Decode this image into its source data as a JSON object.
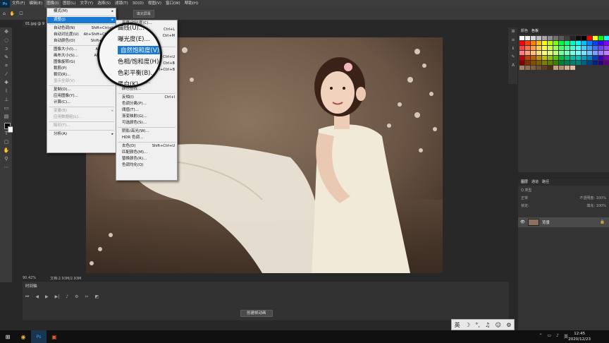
{
  "menubar": {
    "logo": "Ps",
    "items": [
      "文件(F)",
      "编辑(E)",
      "图像(I)",
      "图层(L)",
      "文字(Y)",
      "选择(S)",
      "滤镜(T)",
      "3D(D)",
      "视图(V)",
      "窗口(W)",
      "帮助(H)"
    ]
  },
  "optbar": {
    "hint": "填充屏幕"
  },
  "document": {
    "tab": "01.jpg @ 9"
  },
  "status": {
    "zoom": "90.42%",
    "doc": "文档:2.93M/2.93M"
  },
  "timeline": {
    "title": "时间轴",
    "create_button": "创建帧动画"
  },
  "image_menu": {
    "items": [
      {
        "label": "模式(M)",
        "shortcut": "",
        "arrow": true
      },
      {
        "sep": true
      },
      {
        "label": "调整(J)",
        "shortcut": "",
        "arrow": true,
        "highlight": true
      },
      {
        "sep": true
      },
      {
        "label": "自动色调(N)",
        "shortcut": "Shift+Ctrl+L"
      },
      {
        "label": "自动对比度(U)",
        "shortcut": "Alt+Shift+Ctrl+L"
      },
      {
        "label": "自动颜色(O)",
        "shortcut": "Shift+Ctrl+B"
      },
      {
        "sep": true
      },
      {
        "label": "图像大小(I)...",
        "shortcut": "Alt+Ctrl+I"
      },
      {
        "label": "画布大小(S)...",
        "shortcut": "Alt+Ctrl+C"
      },
      {
        "label": "图像旋转(G)",
        "shortcut": "",
        "arrow": true
      },
      {
        "label": "裁剪(P)",
        "shortcut": ""
      },
      {
        "label": "裁切(R)...",
        "shortcut": ""
      },
      {
        "label": "显示全部(V)",
        "shortcut": "",
        "disabled": true
      },
      {
        "sep": true
      },
      {
        "label": "复制(D)...",
        "shortcut": ""
      },
      {
        "label": "应用图像(Y)...",
        "shortcut": ""
      },
      {
        "label": "计算(C)...",
        "shortcut": ""
      },
      {
        "sep": true
      },
      {
        "label": "变量(B)",
        "shortcut": "",
        "arrow": true,
        "disabled": true
      },
      {
        "label": "应用数据组(L)...",
        "shortcut": "",
        "disabled": true
      },
      {
        "sep": true
      },
      {
        "label": "陷印(T)...",
        "shortcut": "",
        "disabled": true
      },
      {
        "sep": true
      },
      {
        "label": "分析(A)",
        "shortcut": "",
        "arrow": true
      }
    ]
  },
  "adjust_menu": {
    "items": [
      {
        "label": "亮度/对比度(C)...",
        "shortcut": ""
      },
      {
        "label": "色阶(L)...",
        "shortcut": "Ctrl+L"
      },
      {
        "label": "曲线(U)...",
        "shortcut": "Ctrl+M"
      },
      {
        "label": "曝光度(E)...",
        "shortcut": ""
      },
      {
        "sep": true
      },
      {
        "label": "自然饱和度(V)...",
        "shortcut": ""
      },
      {
        "label": "色相/饱和度(H)...",
        "shortcut": "Ctrl+U"
      },
      {
        "label": "色彩平衡(B)...",
        "shortcut": "Ctrl+B"
      },
      {
        "label": "黑白(K)...",
        "shortcut": "Alt+Shift+Ctrl+B"
      },
      {
        "label": "照片滤镜(F)...",
        "shortcut": ""
      },
      {
        "label": "通道混合器(X)...",
        "shortcut": ""
      },
      {
        "label": "颜色查找...",
        "shortcut": ""
      },
      {
        "sep": true
      },
      {
        "label": "反相(I)",
        "shortcut": "Ctrl+I"
      },
      {
        "label": "色调分离(P)...",
        "shortcut": ""
      },
      {
        "label": "阈值(T)...",
        "shortcut": ""
      },
      {
        "label": "渐变映射(G)...",
        "shortcut": ""
      },
      {
        "label": "可选颜色(S)...",
        "shortcut": ""
      },
      {
        "sep": true
      },
      {
        "label": "阴影/高光(W)...",
        "shortcut": ""
      },
      {
        "label": "HDR 色调...",
        "shortcut": ""
      },
      {
        "sep": true
      },
      {
        "label": "去色(D)",
        "shortcut": "Shift+Ctrl+U"
      },
      {
        "label": "匹配颜色(M)...",
        "shortcut": ""
      },
      {
        "label": "替换颜色(R)...",
        "shortcut": ""
      },
      {
        "label": "色调均化(Q)",
        "shortcut": ""
      }
    ]
  },
  "magnifier": {
    "lines": [
      {
        "text": "曲线(U)...",
        "highlight": false
      },
      {
        "text": "曝光度(E)...",
        "highlight": false
      },
      {
        "text": "自然饱和度(V)...",
        "highlight": true
      },
      {
        "text": "色相/饱和度(H)...",
        "highlight": false
      },
      {
        "text": "色彩平衡(B)...",
        "highlight": false
      },
      {
        "text": "黑白(K)...",
        "highlight": false
      }
    ]
  },
  "swatches": {
    "tabs": [
      "颜色",
      "色板"
    ],
    "colors": [
      "#ffffff",
      "#f0f0f0",
      "#d8d8d8",
      "#bfbfbf",
      "#a6a6a6",
      "#8c8c8c",
      "#737373",
      "#595959",
      "#404040",
      "#262626",
      "#0d0d0d",
      "#000000",
      "#ff0000",
      "#ffff00",
      "#00ff00",
      "#00ffff",
      "#ff0000",
      "#ff4000",
      "#ff8000",
      "#ffbf00",
      "#ffff00",
      "#bfff00",
      "#80ff00",
      "#00ff40",
      "#00ff80",
      "#00ffbf",
      "#00ffff",
      "#00bfff",
      "#0080ff",
      "#0040ff",
      "#4000ff",
      "#8000ff",
      "#ff4040",
      "#ff7040",
      "#ffa040",
      "#ffd040",
      "#ffff40",
      "#d0ff40",
      "#a0ff40",
      "#40ff70",
      "#40ffa0",
      "#40ffd0",
      "#40ffff",
      "#40d0ff",
      "#40a0ff",
      "#4070ff",
      "#7040ff",
      "#a040ff",
      "#ff8080",
      "#ffa080",
      "#ffc080",
      "#ffe080",
      "#ffff80",
      "#e0ff80",
      "#c0ff80",
      "#80ffa0",
      "#80ffc0",
      "#80ffe0",
      "#80ffff",
      "#80e0ff",
      "#80c0ff",
      "#80a0ff",
      "#a080ff",
      "#c080ff",
      "#c00000",
      "#c04000",
      "#c06000",
      "#c09000",
      "#c0c000",
      "#90c000",
      "#60c000",
      "#00c040",
      "#00c080",
      "#00c0a0",
      "#00c0c0",
      "#00a0c0",
      "#0080c0",
      "#0040c0",
      "#4000c0",
      "#8000c0",
      "#800000",
      "#803000",
      "#805000",
      "#806000",
      "#808000",
      "#608000",
      "#408000",
      "#008030",
      "#008050",
      "#008070",
      "#008080",
      "#006080",
      "#004080",
      "#002080",
      "#300080",
      "#600080",
      "#a08060",
      "#907050",
      "#806040",
      "#705030",
      "#604020",
      "#503010",
      "#c0a080",
      "#b09070",
      "#d0b090",
      "#e0c0a0"
    ]
  },
  "layers": {
    "tabs": [
      "图层",
      "通道",
      "路径"
    ],
    "filter": "Q 类型",
    "blend": "正常",
    "opacity": "不透明度: 100%",
    "lock": "锁定:",
    "fill": "填充: 100%",
    "bg_layer": "背景"
  },
  "ime": {
    "items": [
      "英",
      "☽",
      "°,",
      "♫",
      "☺",
      "⚙"
    ]
  },
  "taskbar": {
    "time": "12:45",
    "date": "2020/12/23"
  }
}
